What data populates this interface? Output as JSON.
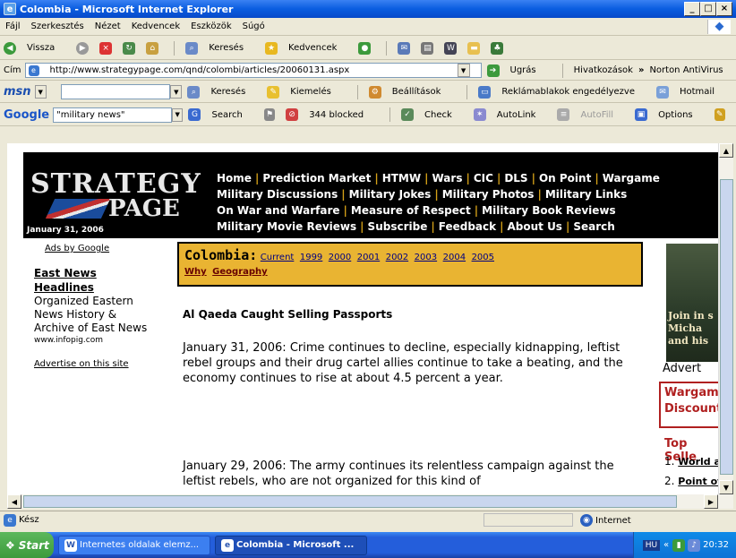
{
  "window": {
    "title": "Colombia - Microsoft Internet Explorer",
    "minimize": "_",
    "maximize": "□",
    "close": "×"
  },
  "menu": [
    "Fájl",
    "Szerkesztés",
    "Nézet",
    "Kedvencek",
    "Eszközök",
    "Súgó"
  ],
  "toolbar": {
    "back": "Vissza",
    "search": "Keresés",
    "favorites": "Kedvencek"
  },
  "address": {
    "label": "Cím",
    "url": "http://www.strategypage.com/qnd/colombi/articles/20060131.aspx",
    "go": "Ugrás",
    "links": "Hivatkozások",
    "norton": "Norton AntiVirus"
  },
  "msn": {
    "logo": "msn",
    "search": "Keresés",
    "highlight": "Kiemelés",
    "settings": "Beállítások",
    "popups": "Reklámablakok engedélyezve",
    "hotmail": "Hotmail"
  },
  "google": {
    "logo": "Google",
    "query": "\"military news\"",
    "search": "Search",
    "blocked": "344 blocked",
    "check": "Check",
    "autolink": "AutoLink",
    "autofill": "AutoFill",
    "options": "Options"
  },
  "page": {
    "logo_top": "STRATEGY",
    "logo_bottom": "PAGE",
    "date": "January 31, 2006",
    "nav": [
      "Home",
      "Prediction Market",
      "HTMW",
      "Wars",
      "CIC",
      "DLS",
      "On Point",
      "Wargame",
      "Military Discussions",
      "Military Jokes",
      "Military Photos",
      "Military Links",
      "On War and Warfare",
      "Measure of Respect",
      "Military Book Reviews",
      "Military Movie Reviews",
      "Subscribe",
      "Feedback",
      "About Us",
      "Search"
    ],
    "left": {
      "ads": "Ads by Google",
      "ad_title": "East News Headlines",
      "ad_text": "Organized Eastern News History & Archive of East News",
      "ad_url": "www.infopig.com",
      "advertise": "Advertise on this site"
    },
    "category": {
      "name": "Colombia:",
      "links": [
        "Current",
        "1999",
        "2000",
        "2001",
        "2002",
        "2003",
        "2004",
        "2005"
      ],
      "sublinks": [
        "Why",
        "Geography"
      ]
    },
    "headline": "Al Qaeda Caught Selling Passports",
    "para1": "January 31, 2006: Crime continues to decline, especially kidnapping, leftist rebel groups and their drug cartel allies continue to take a beating, and the economy continues to rise at about 4.5 percent a year.",
    "para2": "January 29, 2006: The army continues its relentless campaign against the leftist rebels, who are not organized for this kind of",
    "right": {
      "ad_text": "Join in s Micha and his",
      "advert": "Advert",
      "wargame": "Wargame Discount",
      "top_sellers": "Top Selle",
      "item1_num": "1.",
      "item1": "World a",
      "item2_num": "2.",
      "item2": "Point of"
    }
  },
  "status": {
    "text": "Kész",
    "zone": "Internet"
  },
  "taskbar": {
    "start": "Start",
    "task1": "Internetes oldalak elemz...",
    "task2": "Colombia - Microsoft ...",
    "tray_lang": "HU",
    "clock": "20:32"
  }
}
